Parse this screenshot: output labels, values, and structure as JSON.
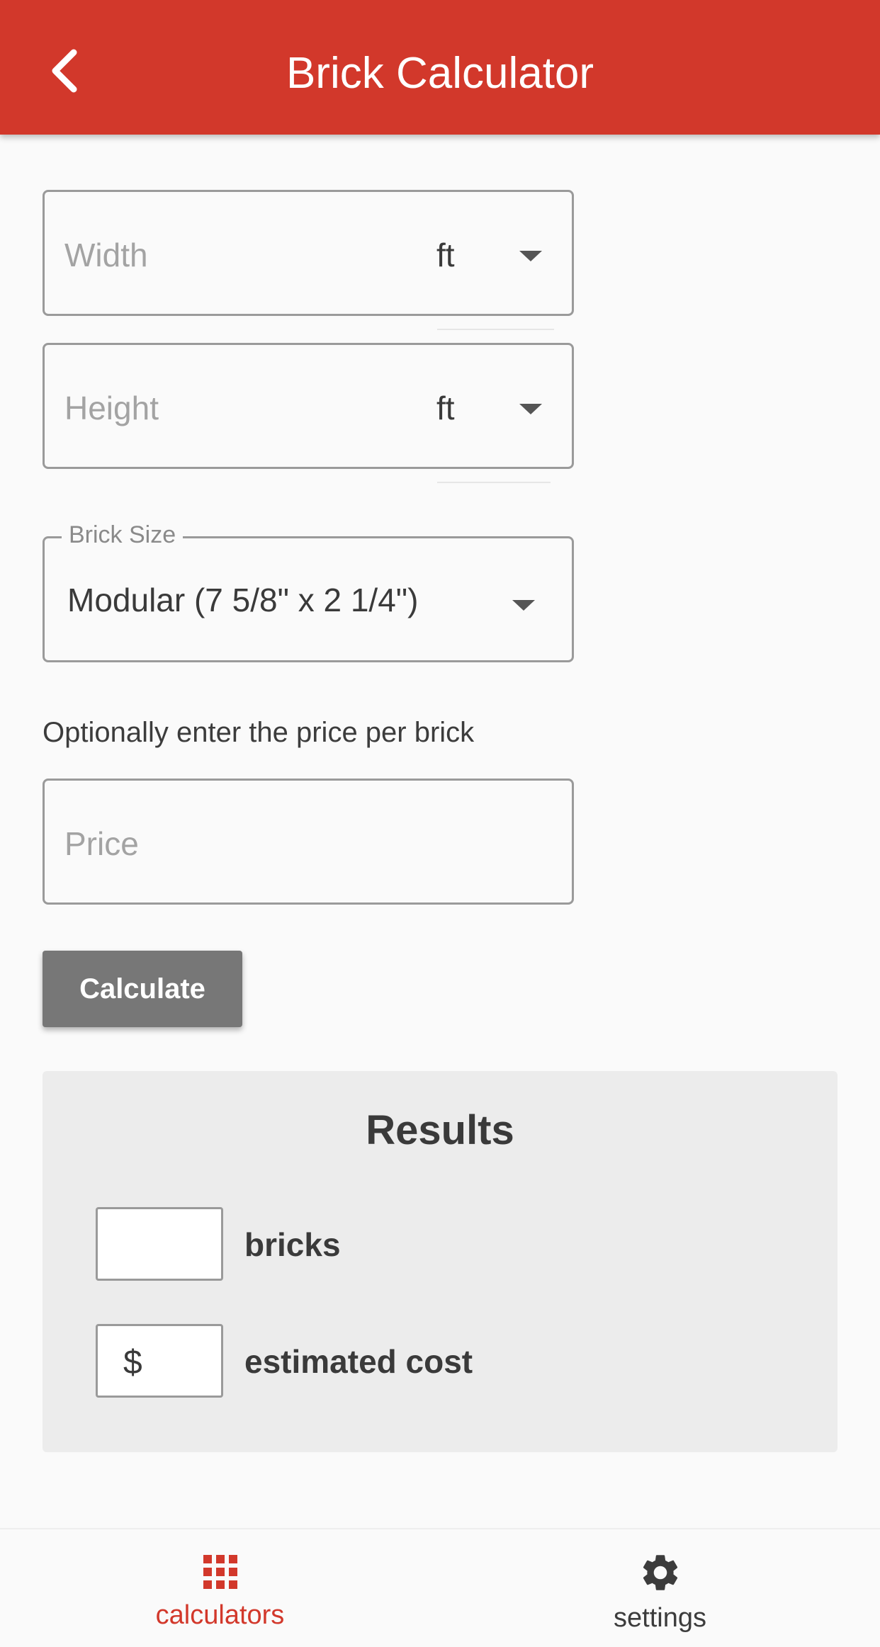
{
  "app_bar": {
    "title": "Brick Calculator",
    "back_icon": "chevron-left-icon",
    "color": "#d2382b"
  },
  "form": {
    "width": {
      "placeholder": "Width",
      "value": "",
      "unit": "ft"
    },
    "height": {
      "placeholder": "Height",
      "value": "",
      "unit": "ft"
    },
    "brick_size": {
      "label": "Brick Size",
      "selected": "Modular (7 5/8\" x 2 1/4\")"
    },
    "price_hint": "Optionally enter the price per brick",
    "price": {
      "placeholder": "Price",
      "value": ""
    },
    "calculate_label": "Calculate"
  },
  "results": {
    "title": "Results",
    "bricks": {
      "value": "",
      "label": "bricks"
    },
    "cost": {
      "prefix": "$",
      "value": "",
      "label": "estimated cost"
    }
  },
  "bottom_nav": {
    "items": [
      {
        "label": "calculators",
        "icon": "grid-icon",
        "active": true,
        "color": "#d2382b"
      },
      {
        "label": "settings",
        "icon": "gear-icon",
        "active": false,
        "color": "#3c3c3c"
      }
    ]
  }
}
